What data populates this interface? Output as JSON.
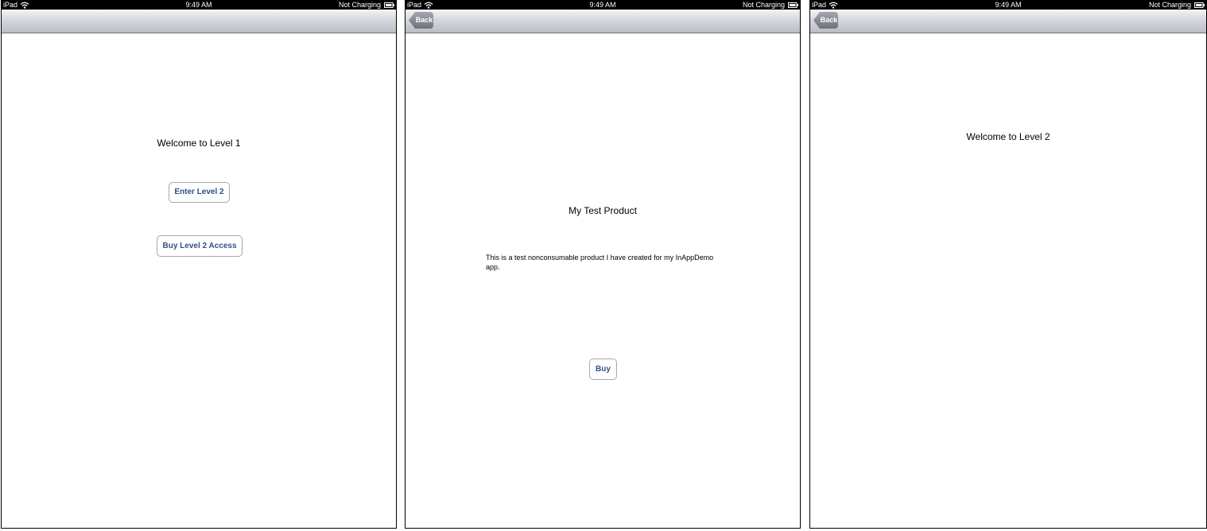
{
  "status_bar": {
    "carrier": "iPad",
    "time": "9:49 AM",
    "charging": "Not Charging"
  },
  "screen1": {
    "welcome": "Welcome to Level 1",
    "enter_button": "Enter Level 2",
    "buy_button": "Buy Level 2 Access"
  },
  "screen2": {
    "back_label": "Back",
    "product_title": "My Test Product",
    "product_description": "This is a test nonconsumable product I have created for my InAppDemo app.",
    "buy_button": "Buy"
  },
  "screen3": {
    "back_label": "Back",
    "welcome": "Welcome to Level 2"
  }
}
